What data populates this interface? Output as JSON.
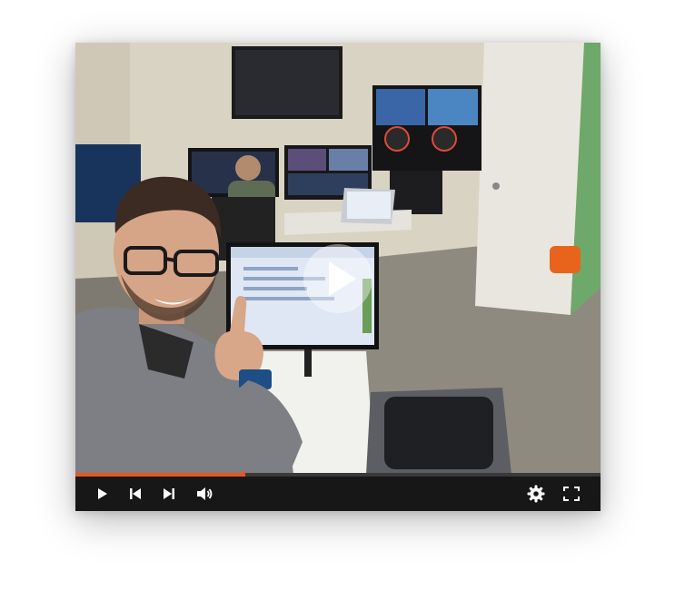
{
  "player": {
    "progress_fraction": 0.32,
    "accent_color": "#e8561f",
    "icons": {
      "big_play": "play-icon",
      "play": "play-icon",
      "previous": "skip-previous-icon",
      "next": "skip-next-icon",
      "volume": "volume-icon",
      "settings": "gear-icon",
      "fullscreen": "fullscreen-icon"
    }
  }
}
